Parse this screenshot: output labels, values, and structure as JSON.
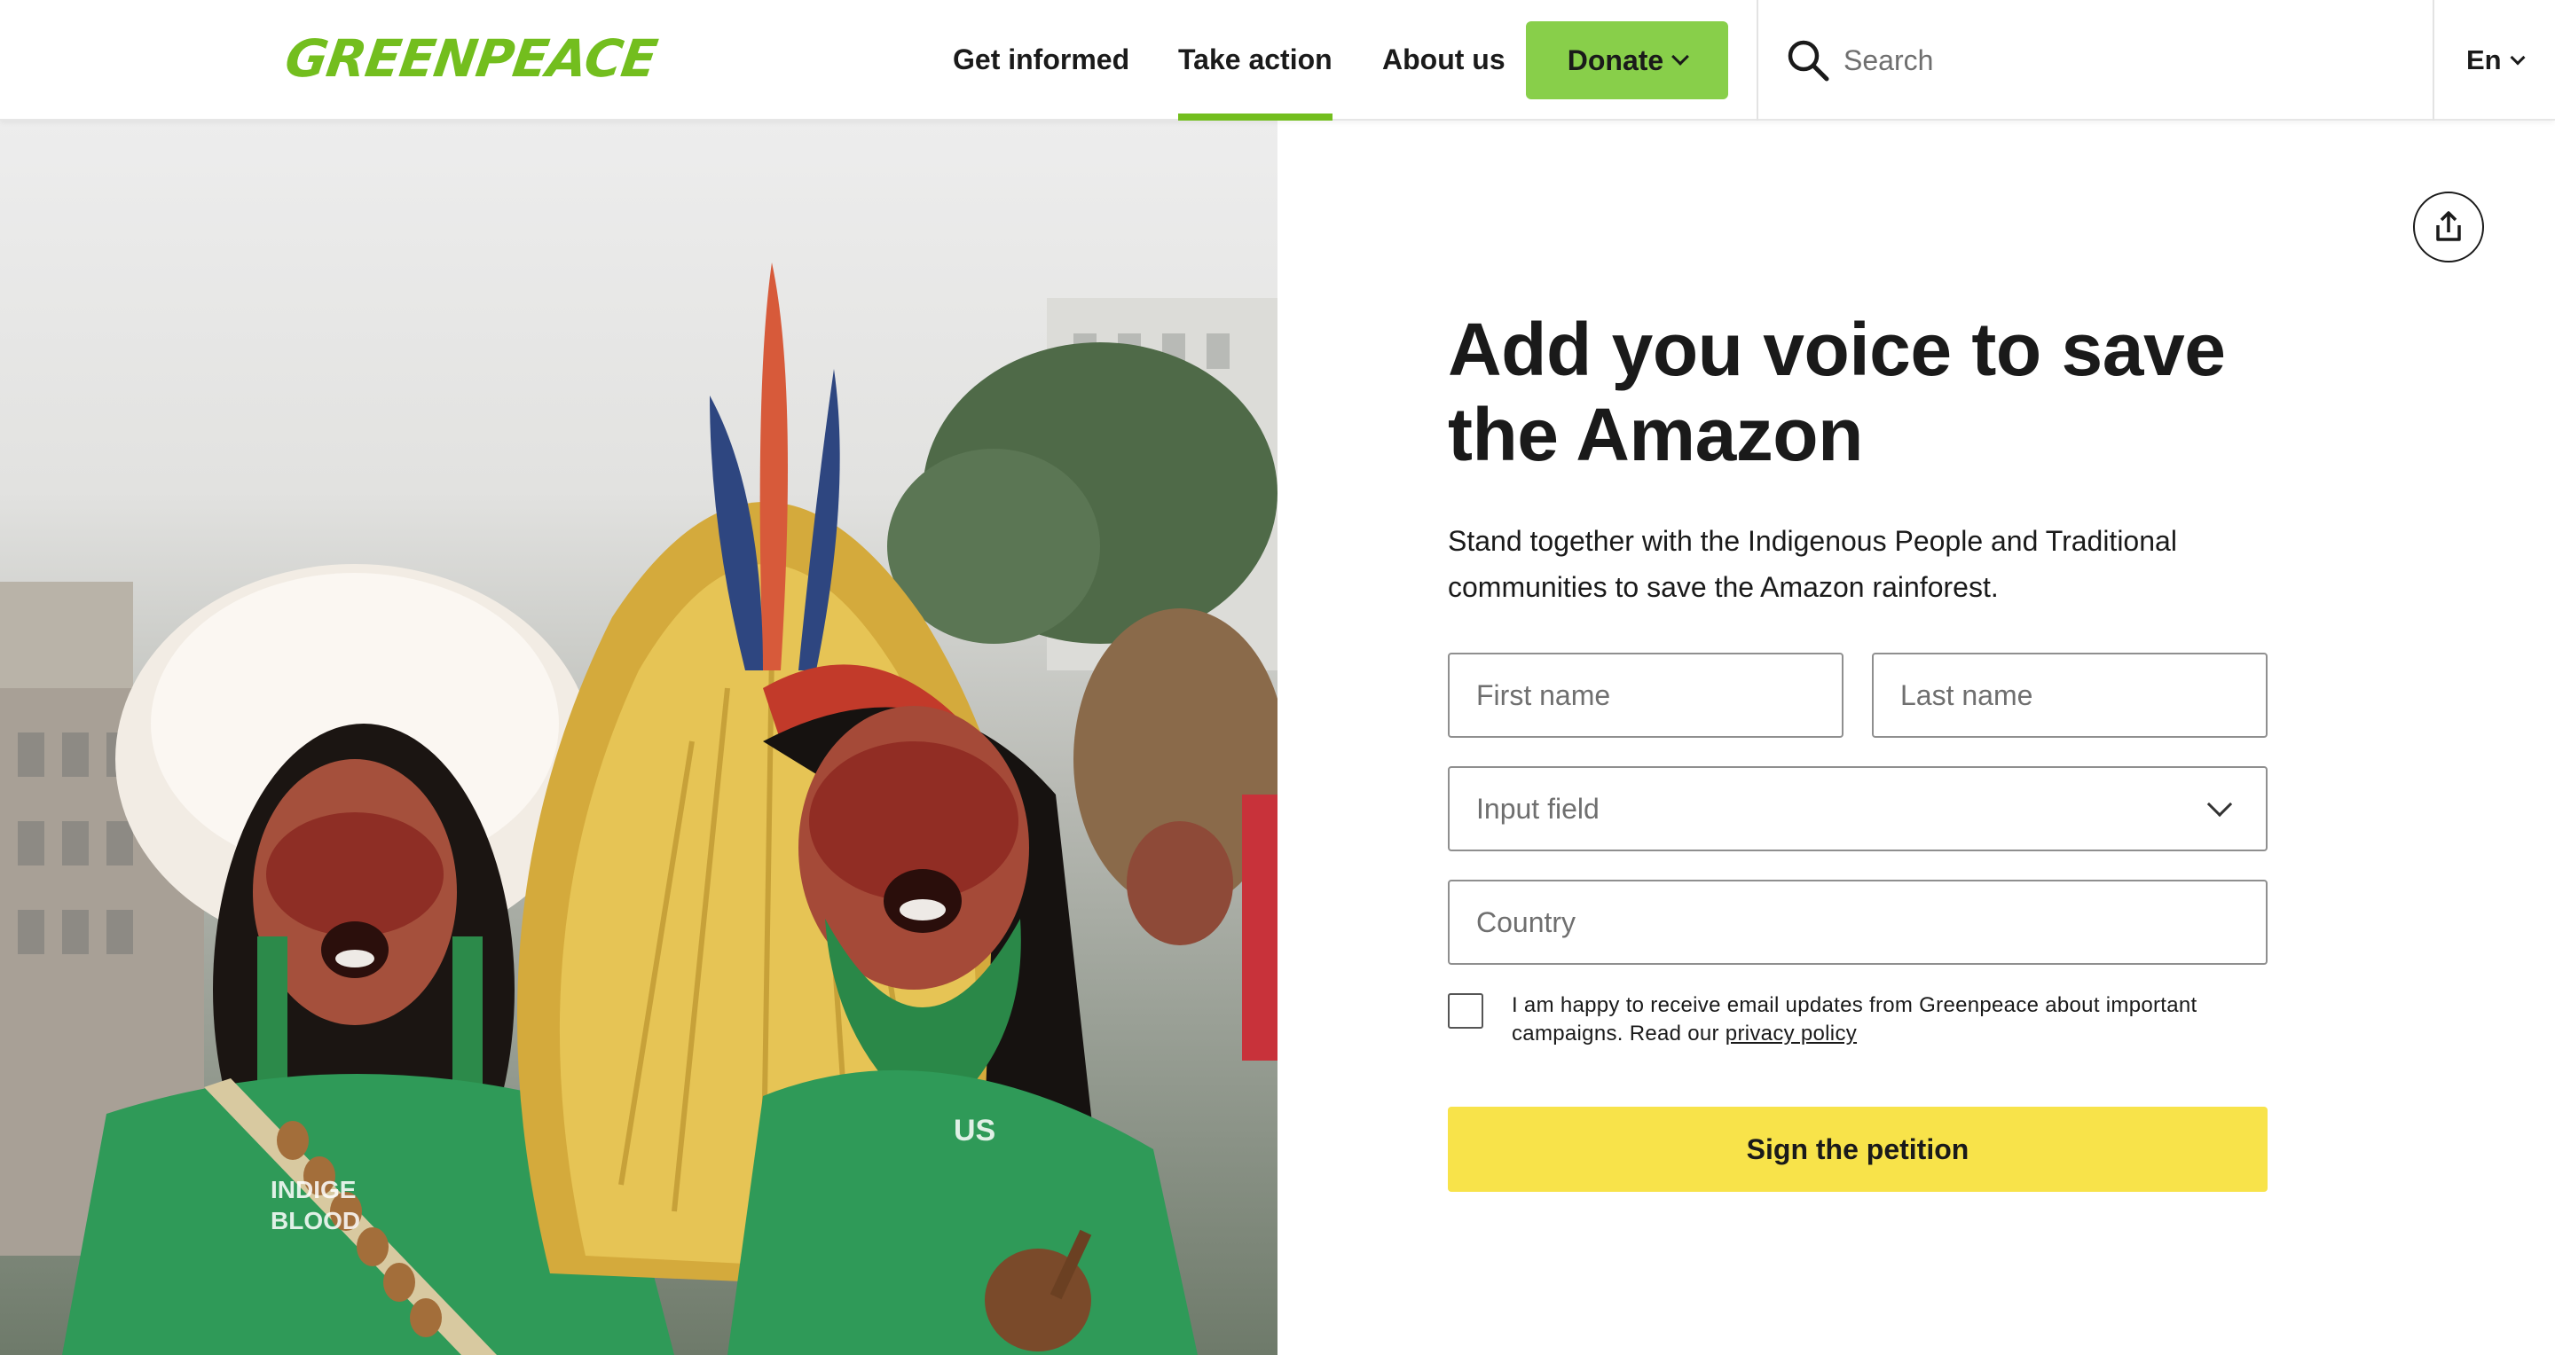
{
  "header": {
    "logo_text": "GREENPEACE",
    "nav": [
      {
        "label": "Get informed",
        "active": false
      },
      {
        "label": "Take action",
        "active": true
      },
      {
        "label": "About us",
        "active": false
      }
    ],
    "donate_label": "Donate",
    "search": {
      "placeholder": "Search",
      "value": ""
    },
    "language": "En"
  },
  "colors": {
    "brand_green": "#73be1e",
    "donate_green": "#88cf4a",
    "submit_yellow": "#f8e34a"
  },
  "hero": {
    "icon": "photo-indigenous-activists"
  },
  "share": {
    "icon": "share-icon"
  },
  "form": {
    "title": "Add you voice to save the Amazon",
    "subtitle": "Stand together with the Indigenous People and Traditional communities to save the Amazon rainforest.",
    "first_name_placeholder": "First name",
    "last_name_placeholder": "Last name",
    "select_placeholder": "Input field",
    "country_placeholder": "Country",
    "consent_text": "I am happy to receive email updates from Greenpeace about important campaigns. Read our ",
    "privacy_link": "privacy policy",
    "consent_checked": false,
    "submit_label": "Sign the petition"
  }
}
